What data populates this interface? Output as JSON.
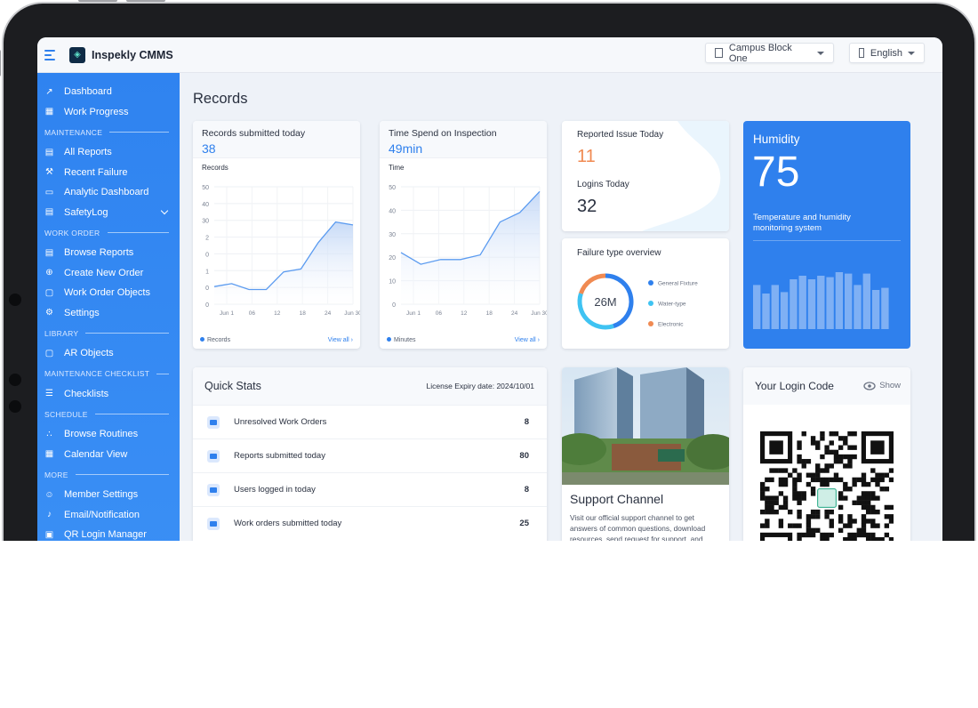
{
  "app": {
    "title": "Inspekly CMMS",
    "logo_glyph": "◈"
  },
  "topbar": {
    "site_select": "Campus Block One",
    "language_select": "English"
  },
  "sidebar": {
    "groups": [
      {
        "items": [
          {
            "label": "Dashboard",
            "icon": "chart-icon"
          },
          {
            "label": "Work Progress",
            "icon": "calendar-icon"
          }
        ]
      },
      {
        "section": "MAINTENANCE",
        "items": [
          {
            "label": "All Reports",
            "icon": "file-icon"
          },
          {
            "label": "Recent Failure",
            "icon": "wrench-icon"
          },
          {
            "label": "Analytic Dashboard",
            "icon": "monitor-icon"
          },
          {
            "label": "SafetyLog",
            "icon": "file-icon",
            "expandable": true
          }
        ]
      },
      {
        "section": "WORK ORDER",
        "items": [
          {
            "label": "Browse Reports",
            "icon": "file-icon"
          },
          {
            "label": "Create New Order",
            "icon": "plus-circle-icon"
          },
          {
            "label": "Work Order Objects",
            "icon": "frame-icon"
          },
          {
            "label": "Settings",
            "icon": "gear-icon"
          }
        ]
      },
      {
        "section": "LIBRARY",
        "items": [
          {
            "label": "AR Objects",
            "icon": "frame-icon"
          }
        ]
      },
      {
        "section": "MAINTENANCE CHECKLIST",
        "items": [
          {
            "label": "Checklists",
            "icon": "list-icon"
          }
        ]
      },
      {
        "section": "SCHEDULE",
        "items": [
          {
            "label": "Browse Routines",
            "icon": "routine-icon"
          },
          {
            "label": "Calendar View",
            "icon": "calendar-icon"
          }
        ]
      },
      {
        "section": "MORE",
        "items": [
          {
            "label": "Member Settings",
            "icon": "users-icon"
          },
          {
            "label": "Email/Notification",
            "icon": "bell-icon"
          },
          {
            "label": "QR Login Manager",
            "icon": "qr-icon"
          }
        ]
      }
    ]
  },
  "page": {
    "title": "Records"
  },
  "records_card": {
    "title": "Records submitted today",
    "value": "38",
    "subtitle": "Records",
    "legend": "Records",
    "view_all": "View all ›",
    "chart_data": {
      "type": "area",
      "x": [
        "Jun 1",
        "",
        "06",
        "",
        "12",
        "",
        "18",
        "",
        "24",
        "Jun 30"
      ],
      "x_ticks": [
        "Jun 1",
        "06",
        "12",
        "18",
        "24",
        "Jun 30"
      ],
      "y_ticks": [
        "50",
        "40",
        "30",
        "2",
        "0",
        "1",
        "0",
        "0"
      ],
      "values": [
        6,
        7,
        5,
        5,
        11,
        12,
        21,
        28,
        27
      ],
      "ylim": [
        0,
        40
      ]
    }
  },
  "time_card": {
    "title": "Time Spend on Inspection",
    "value": "49min",
    "subtitle": "Time",
    "legend": "Minutes",
    "view_all": "View all ›",
    "chart_data": {
      "type": "area",
      "x_ticks": [
        "Jun 1",
        "06",
        "12",
        "18",
        "24",
        "Jun 30"
      ],
      "y_ticks": [
        "50",
        "40",
        "30",
        "20",
        "10",
        "0"
      ],
      "values": [
        22,
        17,
        19,
        19,
        21,
        35,
        39,
        48
      ],
      "ylim": [
        0,
        50
      ]
    }
  },
  "issue_card": {
    "label": "Reported Issue Today",
    "value": "11",
    "logins_label": "Logins Today",
    "logins_value": "32"
  },
  "failure_card": {
    "title": "Failure type overview",
    "center": "26M",
    "chart_data": {
      "type": "pie",
      "series": [
        {
          "name": "General Fixture",
          "value": 45,
          "color": "#2f80ed"
        },
        {
          "name": "Water-type",
          "value": 35,
          "color": "#3fc3f2"
        },
        {
          "name": "Electronic",
          "value": 20,
          "color": "#f08a52"
        }
      ]
    }
  },
  "humidity_card": {
    "title": "Humidity",
    "value": "75",
    "desc": "Temperature and humidity monitoring system",
    "chart_data": {
      "type": "bar",
      "values": [
        62,
        50,
        62,
        52,
        70,
        75,
        70,
        75,
        73,
        80,
        78,
        62,
        78,
        55,
        58
      ]
    }
  },
  "quick_stats": {
    "title": "Quick Stats",
    "license": "License Expiry date: 2024/10/01",
    "rows": [
      {
        "label": "Unresolved Work Orders",
        "value": "8"
      },
      {
        "label": "Reports submitted today",
        "value": "80"
      },
      {
        "label": "Users logged in today",
        "value": "8"
      },
      {
        "label": "Work orders submitted today",
        "value": "25"
      }
    ]
  },
  "support_card": {
    "title": "Support Channel",
    "body": "Visit our official support channel to get answers of common questions, download resources, send request for support, and"
  },
  "login_code": {
    "title": "Your Login Code",
    "show": "Show"
  },
  "colors": {
    "accent": "#2f80ed",
    "orange": "#f08a52",
    "cyan": "#3fc3f2"
  }
}
